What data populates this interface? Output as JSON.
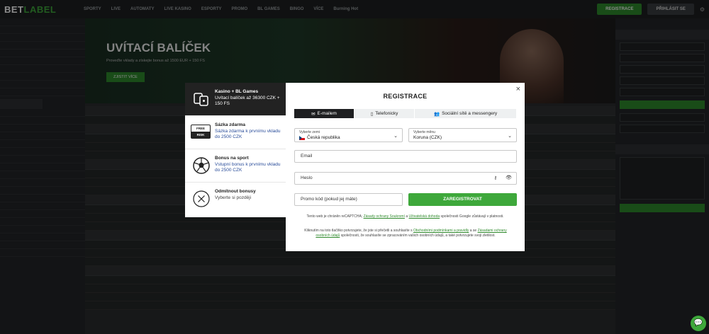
{
  "topbar": {
    "logo_a": "BET",
    "logo_b": "LABEL",
    "nav": [
      "SPORTY",
      "LIVE",
      "AUTOMATY",
      "LIVE KASINO",
      "ESPORTY",
      "PROMO",
      "BL GAMES",
      "BINGO",
      "VÍCE",
      "Burning Hot"
    ],
    "register": "REGISTRACE",
    "login": "PŘIHLÁSIT SE"
  },
  "hero": {
    "title": "UVÍTACÍ BALÍČEK",
    "subtitle": "Proveďte vklady a získejte bonus až 1500 EUR + 150 FS",
    "cta": "ZJISTIT VÍCE"
  },
  "bonus_panel": {
    "items": [
      {
        "title": "Kasino + BL Games",
        "desc": "Uvítací balíček až 36300 CZK + 150 FS",
        "icon": "casino-chips-icon"
      },
      {
        "title": "Sázka zdarma",
        "desc": "Sázka zdarma k prvnímu vkladu do 2500 CZK",
        "icon": "free-bet-icon",
        "badge_a": "FREE",
        "badge_b": "RISK"
      },
      {
        "title": "Bonus na sport",
        "desc": "Vstupní bonus k prvnímu vkladu do 2500 CZK",
        "icon": "soccer-ball-icon"
      },
      {
        "title": "Odmítnout bonusy",
        "desc": "Vyberte si později",
        "icon": "decline-x-icon"
      }
    ]
  },
  "modal": {
    "close": "×",
    "title": "REGISTRACE",
    "tabs": [
      {
        "label": "E-mailem",
        "icon": "envelope-icon",
        "glyph": "✉"
      },
      {
        "label": "Telefonicky",
        "icon": "phone-icon",
        "glyph": "▯"
      },
      {
        "label": "Sociální sítě a messengery",
        "icon": "people-icon",
        "glyph": "👥"
      }
    ],
    "country": {
      "label": "Vyberte zemi",
      "value": "Česká republika"
    },
    "currency": {
      "label": "Vyberte měnu",
      "value": "Koruna (CZK)"
    },
    "email_placeholder": "Email",
    "password_placeholder": "Heslo",
    "promo_placeholder": "Promo kód (pokud jej máte)",
    "submit": "ZAREGISTROVAT",
    "captcha": {
      "pre": "Tento web je chráněn reCAPTCHA; ",
      "link1": "Zásady ochrany Soukromí",
      "mid": " a ",
      "link2": "Uživatelská dohoda",
      "post": " společnosti Google zůstávají v platnosti."
    },
    "terms": {
      "pre": "Kliknutím na toto tlačítko potvrzujete, že jste si přečetli a souhlasíte s ",
      "link1": "Obchodními podmínkami a pravidly",
      "mid": " a se ",
      "link2": "Zásadami ochrany osobních údajů",
      "post": " společnosti, že souhlasíte se zpracováním vašich osobních údajů, a také potvrzujete svoji zletilost."
    }
  },
  "colors": {
    "accent": "#3ea83b",
    "link": "#2a4d9a"
  }
}
